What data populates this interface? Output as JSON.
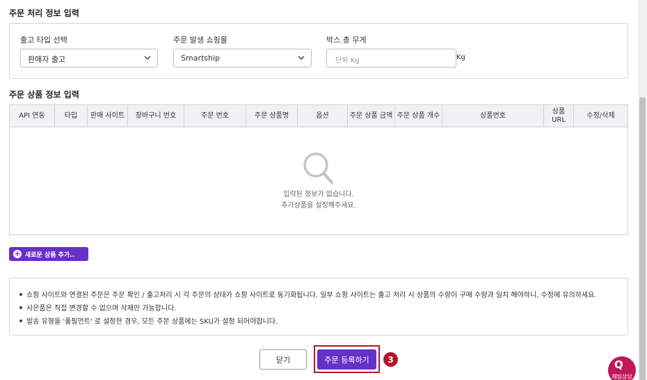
{
  "order_section": {
    "title": "주문 처리 정보 입력",
    "shipping_type": {
      "label": "출고 타입 선택",
      "value": "판매자 출고"
    },
    "mall": {
      "label": "주문 발생 쇼핑몰",
      "value": "Smartship"
    },
    "box_weight": {
      "label": "박스 총 무게",
      "placeholder": "단위 Kg",
      "unit": "Kg"
    }
  },
  "product_section": {
    "title": "주문 상품 정보 입력",
    "columns": [
      "API 연동",
      "타입",
      "판매 사이트",
      "장바구니 번호",
      "주문 번호",
      "주문 상품명",
      "옵션",
      "주문 상품 금액",
      "주문 상품 개수",
      "상품번호",
      "상품 URL",
      "수정/삭제"
    ],
    "empty_line1": "입력된 정보가 없습니다.",
    "empty_line2": "추가상품을 설정해주세요.",
    "add_button": "새로운 상품 추가.."
  },
  "notices": [
    "쇼핑 사이트와 연결된 주문은 주문 확인 / 출고처리 시 각 주문의 상태가 쇼핑 사이트로 동기화됩니다. 일부 쇼핑 사이트는 출고 처리 시 상품의 수량이 구매 수량과 일치 해야하니, 수정에 유의하세요.",
    "사은품은 직접 변경할 수 없으며 삭제만 가능합니다.",
    "발송 유형을 '풀필먼트' 로 설정한 경우, 모든 주문 상품에는 SKU가 설정 되어야합니다."
  ],
  "buttons": {
    "close": "닫기",
    "submit": "주문 등록하기"
  },
  "step_badge": "3",
  "chat_widget": {
    "logo": "Q",
    "label": "채팅상담"
  },
  "colors": {
    "accent": "#6631c6",
    "highlight": "#b3132b"
  }
}
